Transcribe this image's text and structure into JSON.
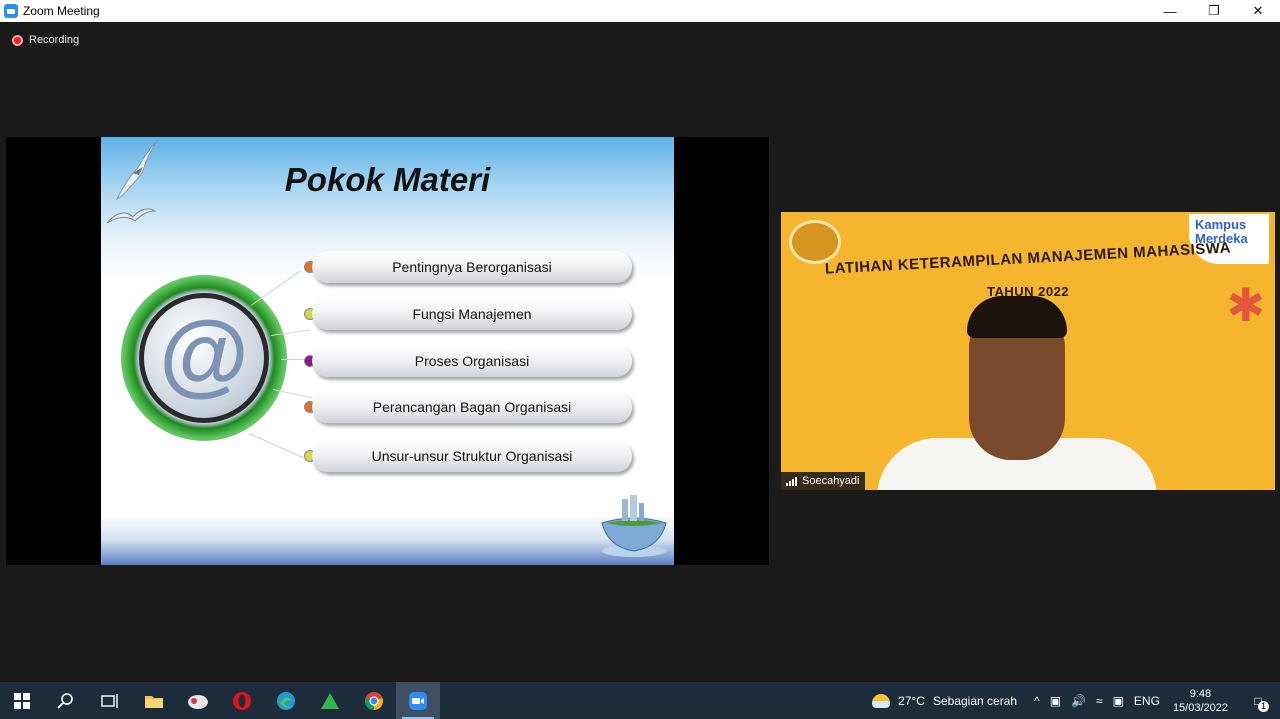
{
  "window": {
    "title": "Zoom Meeting"
  },
  "meeting": {
    "recording_label": "Recording"
  },
  "slide": {
    "title": "Pokok Materi",
    "topics": [
      {
        "label": "Pentingnya Berorganisasi",
        "dot_color": "#e0702c"
      },
      {
        "label": "Fungsi Manajemen",
        "dot_color": "#d8d840"
      },
      {
        "label": "Proses Organisasi",
        "dot_color": "#8a1a8a"
      },
      {
        "label": "Perancangan Bagan Organisasi",
        "dot_color": "#e0702c"
      },
      {
        "label": "Unsur-unsur Struktur Organisasi",
        "dot_color": "#d8d840"
      }
    ]
  },
  "participant": {
    "banner_line_1": "LATIHAN KETERAMPILAN MANAJEMEN MAHASISWA",
    "banner_line_2": "TAHUN 2022",
    "logo_text_1": "Kampus",
    "logo_text_2": "Merdeka",
    "name": "Soecahyadi"
  },
  "taskbar": {
    "weather_temp": "27°C",
    "weather_desc": "Sebagian cerah",
    "language": "ENG",
    "time": "9:48",
    "date": "15/03/2022",
    "notification_count": "1"
  },
  "colors": {
    "zoom_blue": "#2d8cff",
    "taskbar_bg": "#1c2c3a",
    "tile_bg": "#f6b52e"
  }
}
